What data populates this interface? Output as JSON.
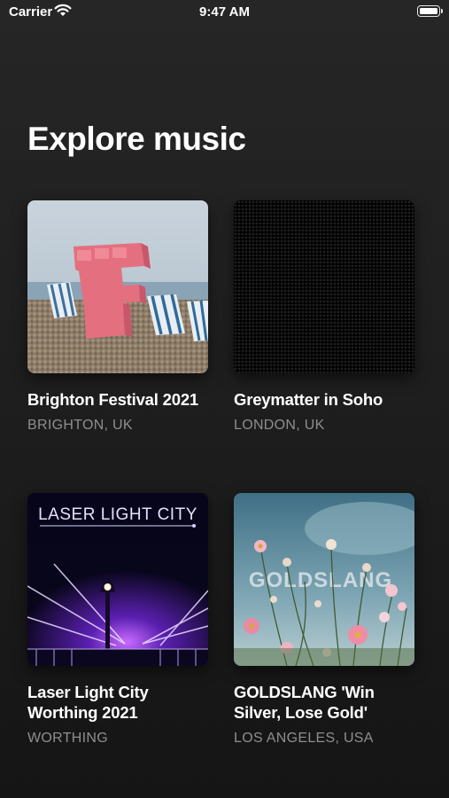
{
  "status_bar": {
    "carrier": "Carrier",
    "time": "9:47 AM",
    "wifi_icon": "wifi-icon",
    "battery_icon": "battery-icon"
  },
  "page": {
    "title": "Explore music"
  },
  "cards": [
    {
      "title": "Brighton Festival 2021",
      "subtitle": "BRIGHTON, UK",
      "image_icon": "festival-artwork"
    },
    {
      "title": "Greymatter in Soho",
      "subtitle": "LONDON, UK",
      "image_icon": "greymatter-artwork"
    },
    {
      "title": "Laser Light City Worthing 2021",
      "subtitle": "WORTHING",
      "image_icon": "laser-light-artwork",
      "image_text": "LASER LIGHT CITY"
    },
    {
      "title": "GOLDSLANG 'Win Silver, Lose Gold'",
      "subtitle": "LOS ANGELES, USA",
      "image_icon": "goldslang-artwork",
      "image_text": "GOLDSLANG"
    }
  ]
}
